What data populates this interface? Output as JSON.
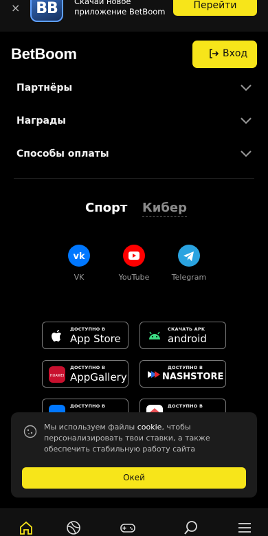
{
  "promo": {
    "close": "×",
    "logo_text": "BB",
    "text_line1": "Скачай новое",
    "text_line2": "приложение BetBoom",
    "button": "Перейти"
  },
  "header": {
    "logo": "BetBoom",
    "login": "Вход"
  },
  "accordion": [
    {
      "label": "Партнёры"
    },
    {
      "label": "Награды"
    },
    {
      "label": "Способы оплаты"
    }
  ],
  "switch": {
    "sport": "Спорт",
    "cyber": "Кибер"
  },
  "social": [
    {
      "name": "VK",
      "icon": "vk-icon",
      "color": "#0077ff"
    },
    {
      "name": "YouTube",
      "icon": "youtube-icon",
      "color": "#ff0000"
    },
    {
      "name": "Telegram",
      "icon": "telegram-icon",
      "color": "#2aa3e0"
    }
  ],
  "stores": [
    {
      "small": "ДОСТУПНО В",
      "big": "App Store",
      "icon": "apple-icon"
    },
    {
      "small": "СКАЧАТЬ APK",
      "big": "android",
      "icon": "android-icon"
    },
    {
      "small": "ДОСТУПНО В",
      "big": "AppGallery",
      "icon": "huawei-icon"
    },
    {
      "small": "ДОСТУПНО В",
      "big": "NASHSTORE",
      "icon": "nashstore-icon"
    },
    {
      "small": "ДОСТУПНО В",
      "big": "",
      "icon": "rustore-icon"
    },
    {
      "small": "ДОСТУПНО В",
      "big": "",
      "icon": "vkstore-icon"
    }
  ],
  "cookie": {
    "text_before": "Мы используем файлы ",
    "link": "cookie",
    "text_after": ", чтобы персонализировать твои ставки, а также обеспечить стабильную работу сайта",
    "ok": "Окей"
  },
  "bottom_nav": [
    {
      "icon": "home-icon",
      "active": true
    },
    {
      "icon": "ball-icon",
      "active": false
    },
    {
      "icon": "gamepad-icon",
      "active": false
    },
    {
      "icon": "search-icon",
      "active": false
    },
    {
      "icon": "menu-icon",
      "active": false
    }
  ],
  "colors": {
    "accent": "#f7e51a",
    "background": "#000000"
  }
}
